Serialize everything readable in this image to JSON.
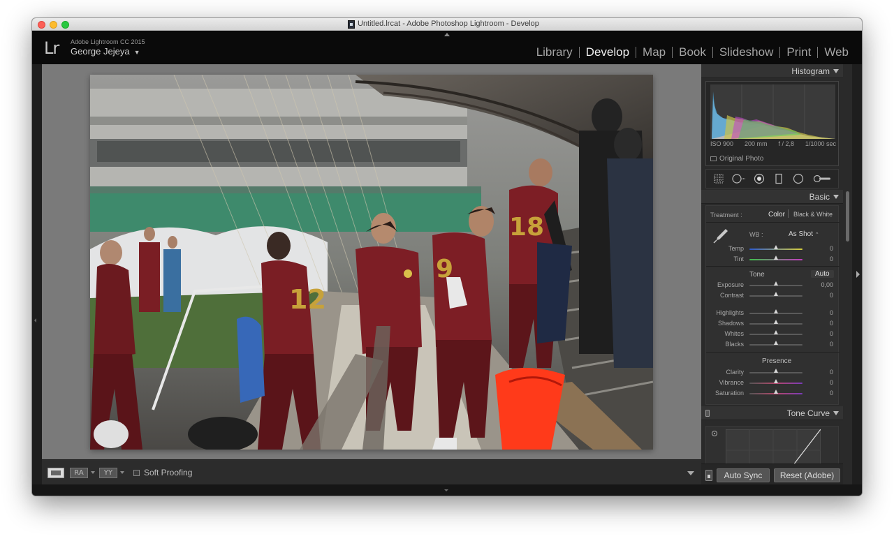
{
  "window": {
    "title": "Untitled.lrcat - Adobe Photoshop Lightroom - Develop"
  },
  "identity": {
    "logo": "Lr",
    "version": "Adobe Lightroom CC 2015",
    "user": "George Jejeya",
    "user_menu_icon": "triangle-down-icon"
  },
  "modules": [
    {
      "label": "Library",
      "active": false
    },
    {
      "label": "Develop",
      "active": true
    },
    {
      "label": "Map",
      "active": false
    },
    {
      "label": "Book",
      "active": false
    },
    {
      "label": "Slideshow",
      "active": false
    },
    {
      "label": "Print",
      "active": false
    },
    {
      "label": "Web",
      "active": false
    }
  ],
  "toolbar": {
    "view_ra": "RA",
    "view_yy": "YY",
    "soft_proofing": "Soft Proofing",
    "soft_proofing_checked": false
  },
  "histogram": {
    "header": "Histogram",
    "iso": "ISO 900",
    "focal": "200 mm",
    "aperture": "f / 2,8",
    "shutter": "1/1000 sec",
    "original_photo": "Original Photo"
  },
  "basic": {
    "header": "Basic",
    "treatment_label": "Treatment :",
    "treatment_color": "Color",
    "treatment_bw": "Black & White",
    "wb_label": "WB :",
    "wb_value": "As Shot",
    "temp_label": "Temp",
    "temp_value": "0",
    "tint_label": "Tint",
    "tint_value": "0",
    "tone_label": "Tone",
    "auto_label": "Auto",
    "exposure_label": "Exposure",
    "exposure_value": "0,00",
    "contrast_label": "Contrast",
    "contrast_value": "0",
    "highlights_label": "Highlights",
    "highlights_value": "0",
    "shadows_label": "Shadows",
    "shadows_value": "0",
    "whites_label": "Whites",
    "whites_value": "0",
    "blacks_label": "Blacks",
    "blacks_value": "0",
    "presence_label": "Presence",
    "clarity_label": "Clarity",
    "clarity_value": "0",
    "vibrance_label": "Vibrance",
    "vibrance_value": "0",
    "saturation_label": "Saturation",
    "saturation_value": "0"
  },
  "tone_curve": {
    "header": "Tone Curve"
  },
  "sync": {
    "auto_sync": "Auto Sync",
    "reset": "Reset (Adobe)"
  },
  "colors": {
    "panel_bg": "#2a2a2a",
    "canvas_bg": "#7a7a7a",
    "active_module": "#f0f0f0",
    "inactive_module": "#a5a5a5",
    "jersey": "#6b1a1f",
    "bib_orange": "#ff3a1a"
  }
}
